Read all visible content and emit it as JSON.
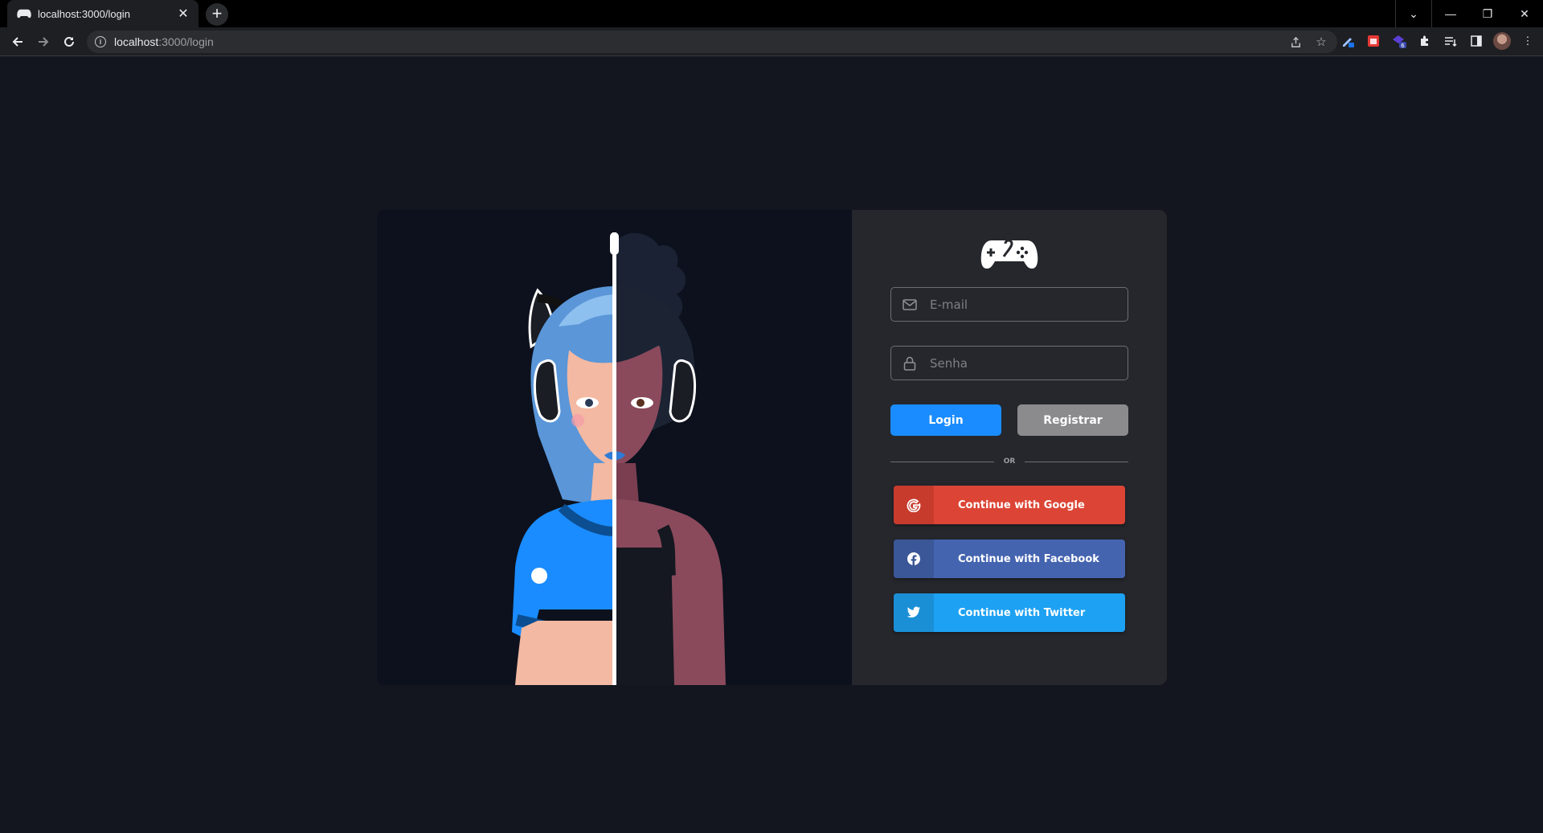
{
  "browser": {
    "tab_title": "localhost:3000/login",
    "tab_close": "✕",
    "new_tab": "+",
    "url_host": "localhost",
    "url_path": ":3000/login",
    "ext_badge": "6",
    "window_controls": {
      "tab_search": "⌄",
      "minimize": "—",
      "restore": "❐",
      "close": "✕"
    }
  },
  "login": {
    "email_placeholder": "E-mail",
    "password_placeholder": "Senha",
    "login_label": "Login",
    "register_label": "Registrar",
    "or_label": "OR",
    "google_label": "Continue with Google",
    "facebook_label": "Continue with Facebook",
    "twitter_label": "Continue with Twitter"
  },
  "colors": {
    "page_bg": "#13161f",
    "form_bg": "#25272c",
    "art_bg": "#0c111d",
    "login": "#1a8cff",
    "register": "#8b8b8e",
    "google": "#dc4535",
    "facebook": "#4464b0",
    "twitter": "#1da1f2"
  }
}
